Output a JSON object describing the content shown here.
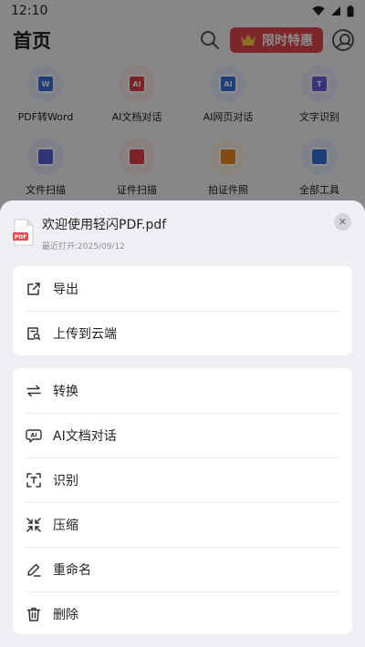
{
  "status_bar": {
    "time": "12:10"
  },
  "header": {
    "title": "首页",
    "promo_label": "限时特惠"
  },
  "tools": [
    {
      "label": "PDF转Word",
      "icon": "word-doc-icon",
      "color": "#3b6fe0",
      "text": "W"
    },
    {
      "label": "AI文档对话",
      "icon": "ai-chat-icon",
      "color": "#e0414a",
      "text": "AI"
    },
    {
      "label": "AI网页对话",
      "icon": "ai-web-icon",
      "color": "#3b6fe0",
      "text": "AI"
    },
    {
      "label": "文字识别",
      "icon": "text-recognition-icon",
      "color": "#6a5ce0",
      "text": "T"
    },
    {
      "label": "文件扫描",
      "icon": "file-scan-icon",
      "color": "#5b5fe0",
      "text": ""
    },
    {
      "label": "证件扫描",
      "icon": "id-scan-icon",
      "color": "#e0414a",
      "text": ""
    },
    {
      "label": "拍证件照",
      "icon": "id-photo-icon",
      "color": "#f08a24",
      "text": ""
    },
    {
      "label": "全部工具",
      "icon": "all-tools-icon",
      "color": "#3b6fe0",
      "text": ""
    }
  ],
  "sheet": {
    "file_name": "欢迎使用轻闪PDF.pdf",
    "file_meta": "最近打开:2025/09/12",
    "file_badge": "PDF",
    "close_glyph": "✕",
    "group1": [
      {
        "label": "导出",
        "icon": "export-icon"
      },
      {
        "label": "上传到云端",
        "icon": "cloud-upload-icon"
      }
    ],
    "group2": [
      {
        "label": "转换",
        "icon": "convert-icon"
      },
      {
        "label": "AI文档对话",
        "icon": "ai-chat-icon"
      },
      {
        "label": "识别",
        "icon": "scan-recognize-icon"
      },
      {
        "label": "压缩",
        "icon": "compress-icon"
      },
      {
        "label": "重命名",
        "icon": "rename-icon"
      },
      {
        "label": "删除",
        "icon": "delete-icon"
      }
    ]
  }
}
